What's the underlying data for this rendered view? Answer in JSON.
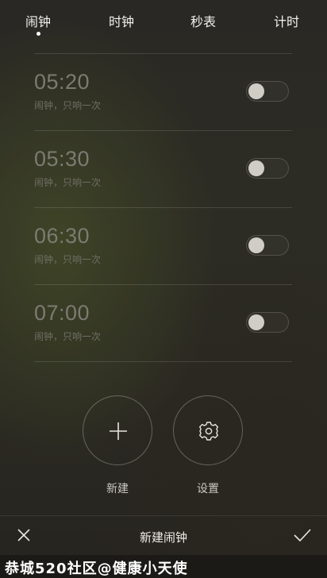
{
  "tabs": [
    {
      "label": "闹钟",
      "active": true
    },
    {
      "label": "时钟",
      "active": false
    },
    {
      "label": "秒表",
      "active": false
    },
    {
      "label": "计时",
      "active": false
    }
  ],
  "alarms": [
    {
      "time": "05:20",
      "subtitle": "闹钟，只响一次",
      "enabled": false
    },
    {
      "time": "05:30",
      "subtitle": "闹钟，只响一次",
      "enabled": false
    },
    {
      "time": "06:30",
      "subtitle": "闹钟，只响一次",
      "enabled": false
    },
    {
      "time": "07:00",
      "subtitle": "闹钟，只响一次",
      "enabled": false
    }
  ],
  "actions": {
    "new_label": "新建",
    "new_icon": "plus-icon",
    "settings_label": "设置",
    "settings_icon": "gear-icon"
  },
  "bottom_bar": {
    "title": "新建闹钟",
    "cancel_icon": "close-icon",
    "confirm_icon": "check-icon"
  },
  "watermark": "恭城520社区@健康小天使"
}
